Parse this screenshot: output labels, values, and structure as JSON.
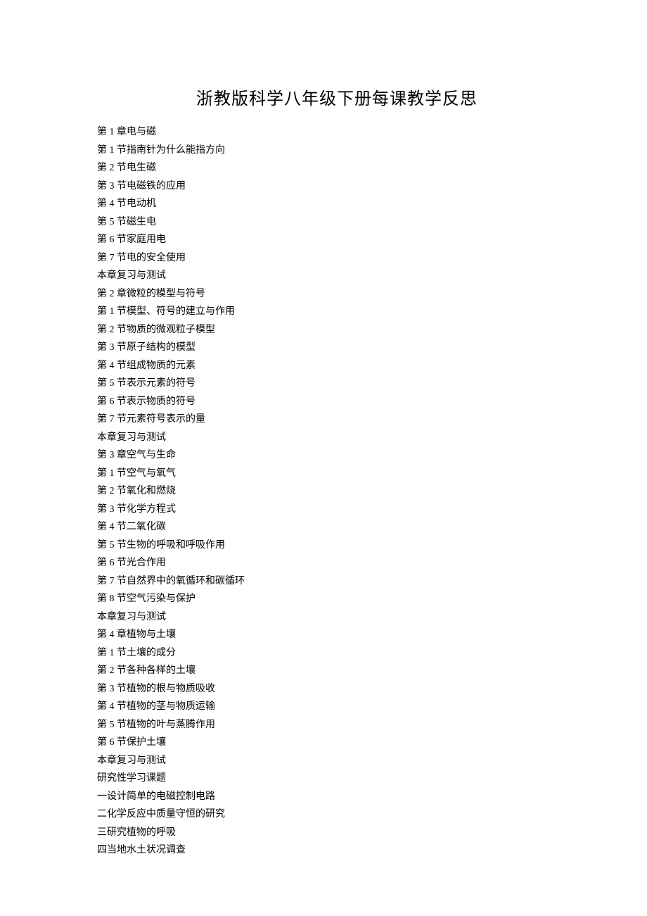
{
  "title": "浙教版科学八年级下册每课教学反思",
  "lines": [
    "第 1 章电与磁",
    "第 1 节指南针为什么能指方向",
    "第 2 节电生磁",
    "第 3 节电磁铁的应用",
    "第 4 节电动机",
    "第 5 节磁生电",
    "第 6 节家庭用电",
    "第 7 节电的安全使用",
    "本章复习与测试",
    "第 2 章微粒的模型与符号",
    "第 1 节模型、符号的建立与作用",
    "第 2 节物质的微观粒子模型",
    "第 3 节原子结构的模型",
    "第 4 节组成物质的元素",
    "第 5 节表示元素的符号",
    "第 6 节表示物质的符号",
    "第 7 节元素符号表示的量",
    "本章复习与测试",
    "第 3 章空气与生命",
    "第 1 节空气与氧气",
    "第 2 节氧化和燃烧",
    "第 3 节化学方程式",
    "第 4 节二氧化碳",
    "第 5 节生物的呼吸和呼吸作用",
    "第 6 节光合作用",
    "第 7 节自然界中的氧循环和碳循环",
    "第 8 节空气污染与保护",
    "本章复习与测试",
    "第 4 章植物与土壤",
    "第 1 节土壤的成分",
    "第 2 节各种各样的土壤",
    "第 3 节植物的根与物质吸收",
    "第 4 节植物的茎与物质运输",
    "第 5 节植物的叶与蒸腾作用",
    "第 6 节保护土壤",
    "本章复习与测试",
    "研究性学习课题",
    "一设计简单的电磁控制电路",
    "二化学反应中质量守恒的研究",
    "三研究植物的呼吸",
    "四当地水土状况调查"
  ]
}
